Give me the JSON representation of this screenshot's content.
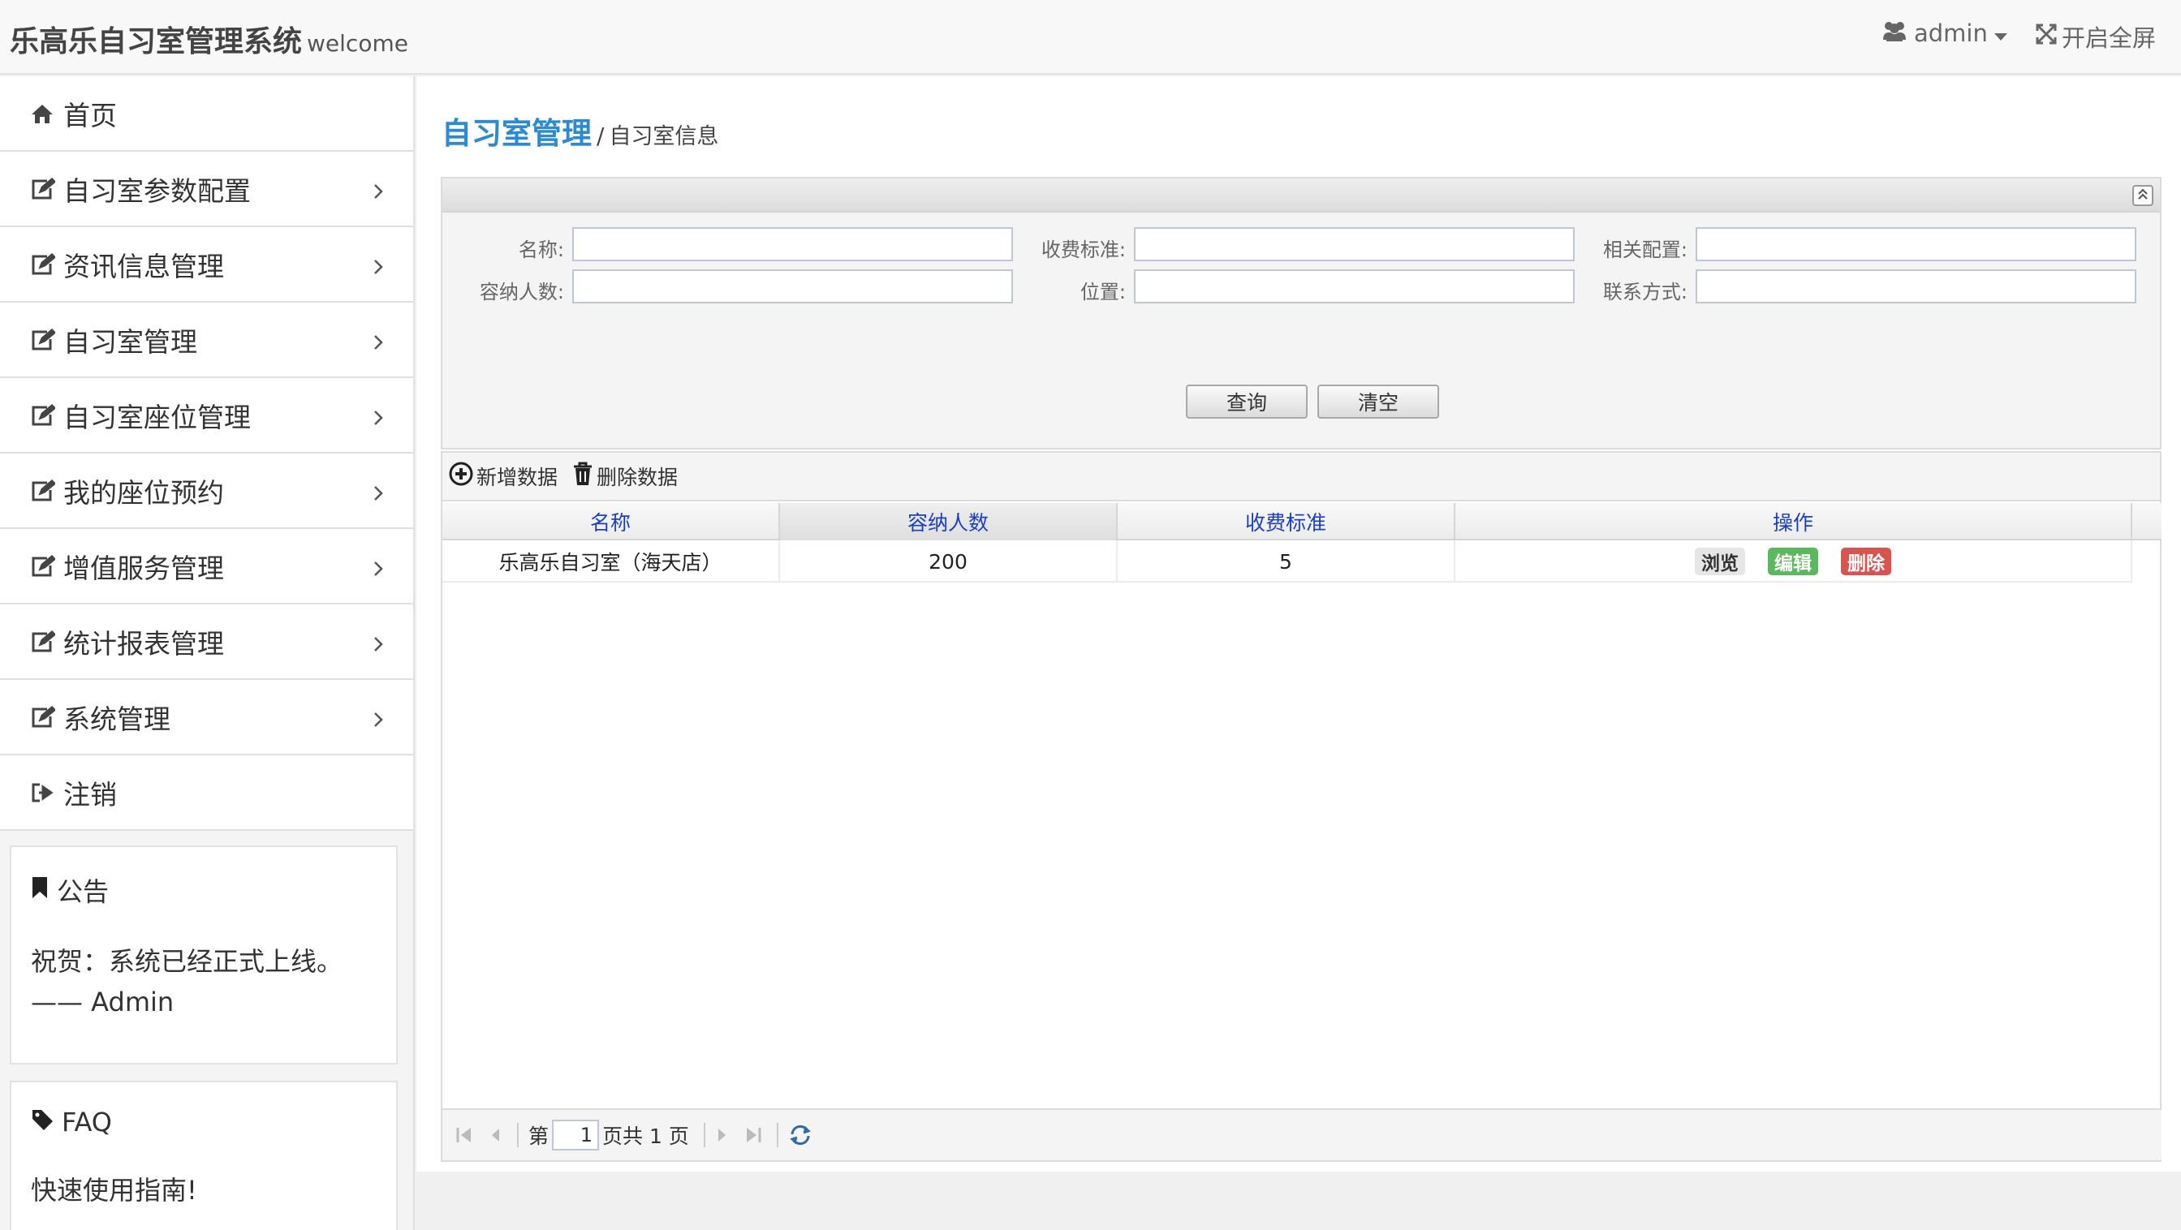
{
  "header": {
    "title": "乐高乐自习室管理系统",
    "welcome": "welcome",
    "user": "admin",
    "fullscreen": "开启全屏"
  },
  "sidebar": {
    "items": [
      {
        "label": "首页",
        "icon": "home-icon",
        "has_arrow": false
      },
      {
        "label": "自习室参数配置",
        "icon": "edit-icon",
        "has_arrow": true
      },
      {
        "label": "资讯信息管理",
        "icon": "edit-icon",
        "has_arrow": true
      },
      {
        "label": "自习室管理",
        "icon": "edit-icon",
        "has_arrow": true
      },
      {
        "label": "自习室座位管理",
        "icon": "edit-icon",
        "has_arrow": true
      },
      {
        "label": "我的座位预约",
        "icon": "edit-icon",
        "has_arrow": true
      },
      {
        "label": "增值服务管理",
        "icon": "edit-icon",
        "has_arrow": true
      },
      {
        "label": "统计报表管理",
        "icon": "edit-icon",
        "has_arrow": true
      },
      {
        "label": "系统管理",
        "icon": "edit-icon",
        "has_arrow": true
      },
      {
        "label": "注销",
        "icon": "logout-icon",
        "has_arrow": false
      }
    ],
    "notice": {
      "title": "公告",
      "line1": "祝贺：系统已经正式上线。",
      "line2": "—— Admin"
    },
    "faq": {
      "title": "FAQ",
      "text": "快速使用指南!"
    }
  },
  "breadcrumb": {
    "main": "自习室管理",
    "separator": "/",
    "sub": "自习室信息"
  },
  "search": {
    "fields": [
      {
        "label": "名称:",
        "value": ""
      },
      {
        "label": "收费标准:",
        "value": ""
      },
      {
        "label": "相关配置:",
        "value": ""
      },
      {
        "label": "容纳人数:",
        "value": ""
      },
      {
        "label": "位置:",
        "value": ""
      },
      {
        "label": "联系方式:",
        "value": ""
      }
    ],
    "query_label": "查询",
    "clear_label": "清空"
  },
  "toolbar": {
    "add_label": "新增数据",
    "delete_label": "删除数据"
  },
  "table": {
    "columns": [
      "名称",
      "容纳人数",
      "收费标准",
      "操作"
    ],
    "rows": [
      {
        "name": "乐高乐自习室（海天店）",
        "capacity": "200",
        "fee": "5",
        "actions": [
          "浏览",
          "编辑",
          "删除"
        ]
      }
    ]
  },
  "pager": {
    "page_prefix": "第",
    "page": "1",
    "page_suffix": "页共 1 页"
  },
  "colors": {
    "accent": "#2b8ad0",
    "header_text": "#1a3fc4",
    "edit": "#5cb85c",
    "delete": "#d9534f"
  }
}
